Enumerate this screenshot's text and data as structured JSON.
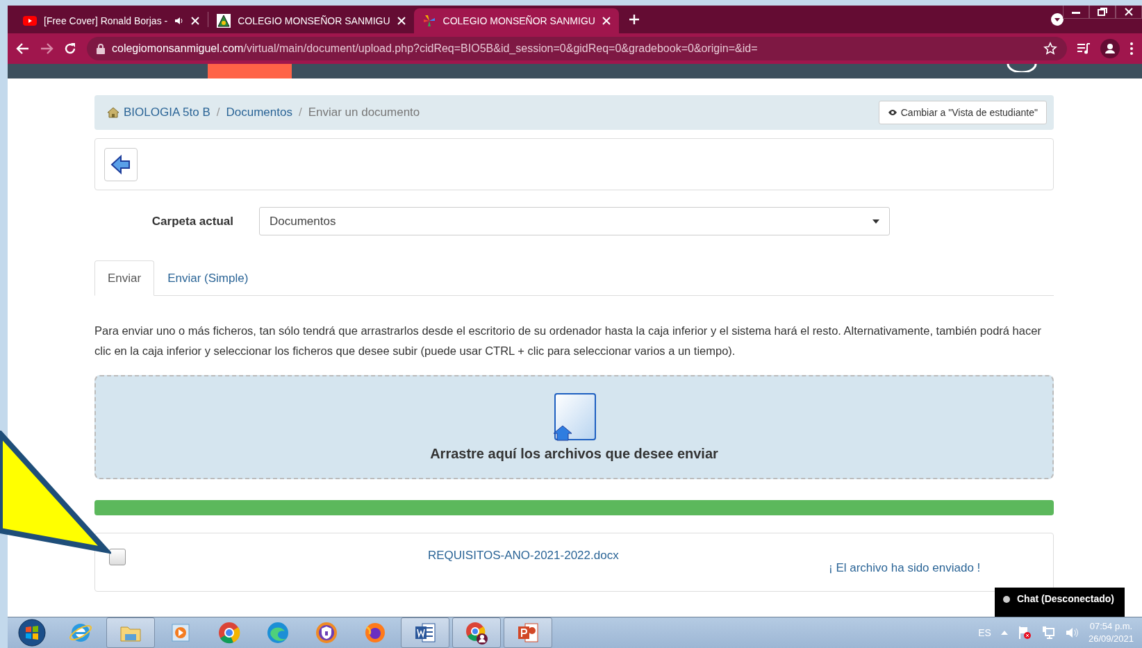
{
  "browser": {
    "tabs": [
      {
        "title": "[Free Cover] Ronald Borjas -",
        "kind": "video",
        "audio": true,
        "selected": false
      },
      {
        "title": "COLEGIO MONSEÑOR SANMIGU",
        "kind": "school",
        "audio": false,
        "selected": false
      },
      {
        "title": "COLEGIO MONSEÑOR SANMIGU",
        "kind": "pinwheel",
        "audio": false,
        "selected": true
      }
    ],
    "url": {
      "host": "colegiomonsanmiguel.com",
      "path": "/virtual/main/document/upload.php?cidReq=BIO5B&id_session=0&gidReq=0&gradebook=0&origin=&id="
    }
  },
  "breadcrumb": {
    "separator": "/",
    "items": [
      {
        "label": "BIOLOGIA 5to B",
        "link": true
      },
      {
        "label": "Documentos",
        "link": true
      },
      {
        "label": "Enviar un documento",
        "link": false
      }
    ]
  },
  "student_view_button": "Cambiar a \"Vista de estudiante\"",
  "folder": {
    "label": "Carpeta actual",
    "value": "Documentos"
  },
  "tabs": [
    {
      "label": "Enviar",
      "selected": true
    },
    {
      "label": "Enviar (Simple)",
      "selected": false
    }
  ],
  "instructions": "Para enviar uno o más ficheros, tan sólo tendrá que arrastrarlos desde el escritorio de su ordenador hasta la caja inferior y el sistema hará el resto. Alternativamente, también podrá hacer clic en la caja inferior y seleccionar los ficheros que desee subir (puede usar CTRL + clic para seleccionar varios a un tiempo).",
  "dropzone": {
    "label": "Arrastre aquí los archivos que desee enviar"
  },
  "upload_progress": {
    "level": 1
  },
  "files": [
    {
      "name": "REQUISITOS-ANO-2021-2022.docx",
      "status": "¡ El archivo ha sido enviado !",
      "checked": false
    }
  ],
  "chat": {
    "label": "Chat (Desconectado)"
  },
  "taskbar": {
    "apps": [
      {
        "kind": "ie",
        "open": false
      },
      {
        "kind": "folder",
        "open": true
      },
      {
        "kind": "media",
        "open": false
      },
      {
        "kind": "chrome",
        "open": false
      },
      {
        "kind": "edge",
        "open": false
      },
      {
        "kind": "vpn",
        "open": false
      },
      {
        "kind": "firefox",
        "open": false
      },
      {
        "kind": "word",
        "open": true
      },
      {
        "kind": "chrome-profile",
        "open": true
      },
      {
        "kind": "powerpoint",
        "open": true
      }
    ],
    "language": "ES",
    "time": "07:54 p.m.",
    "date": "26/09/2021"
  }
}
